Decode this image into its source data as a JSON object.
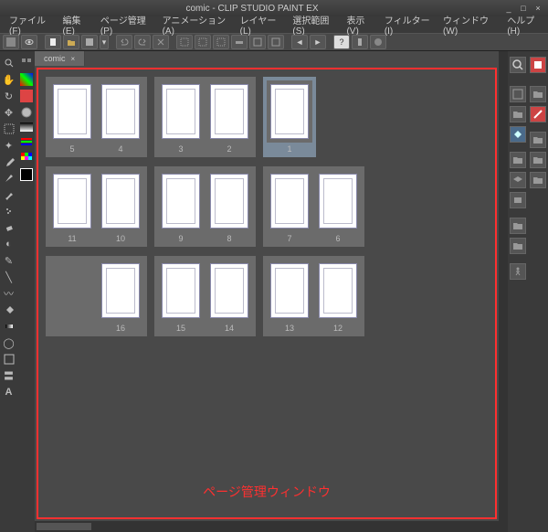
{
  "window": {
    "title": "comic - CLIP STUDIO PAINT EX"
  },
  "menus": [
    "ファイル(F)",
    "編集(E)",
    "ページ管理(P)",
    "アニメーション(A)",
    "レイヤー(L)",
    "選択範囲(S)",
    "表示(V)",
    "フィルター(I)",
    "ウィンドウ(W)",
    "ヘルプ(H)"
  ],
  "tab": {
    "name": "comic",
    "close": "×"
  },
  "pages": {
    "rows": [
      [
        {
          "nums": [
            "5",
            "4"
          ]
        },
        {
          "nums": [
            "3",
            "2"
          ]
        },
        {
          "nums": [
            "1"
          ],
          "selected": true
        }
      ],
      [
        {
          "nums": [
            "11",
            "10"
          ]
        },
        {
          "nums": [
            "9",
            "8"
          ]
        },
        {
          "nums": [
            "7",
            "6"
          ]
        }
      ],
      [
        {
          "nums": [
            "",
            "16"
          ]
        },
        {
          "nums": [
            "15",
            "14"
          ]
        },
        {
          "nums": [
            "13",
            "12"
          ]
        }
      ]
    ]
  },
  "caption": "ページ管理ウィンドウ",
  "winctrl": {
    "min": "_",
    "max": "□",
    "close": "×"
  }
}
